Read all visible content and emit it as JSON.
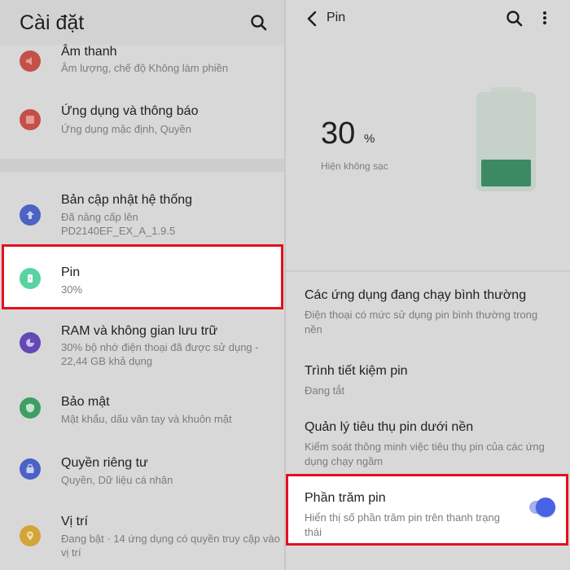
{
  "settings": {
    "title": "Cài đặt",
    "items": [
      {
        "key": "sound",
        "title": "Âm thanh",
        "subtitle": "Âm lượng, chế độ Không làm phiền",
        "color": "#c4504a"
      },
      {
        "key": "apps",
        "title": "Ứng dụng và thông báo",
        "subtitle": "Ứng dụng mặc định, Quyền",
        "color": "#c4504a"
      },
      {
        "key": "update",
        "title": "Bản cập nhật hệ thống",
        "subtitle": "Đã nâng cấp lên PD2140EF_EX_A_1.9.5",
        "color": "#4a63c4"
      },
      {
        "key": "battery",
        "title": "Pin",
        "subtitle": "30%",
        "color": "#59d3a1"
      },
      {
        "key": "ram",
        "title": "RAM và không gian lưu trữ",
        "subtitle": "30% bộ nhớ điện thoại đã được sử dụng - 22,44 GB khả dụng",
        "color": "#6448b5"
      },
      {
        "key": "security",
        "title": "Bảo mật",
        "subtitle": "Mật khẩu, dấu vân tay và khuôn mặt",
        "color": "#3f9e63"
      },
      {
        "key": "privacy",
        "title": "Quyền riêng tư",
        "subtitle": "Quyền, Dữ liệu cá nhân",
        "color": "#4a63c4"
      },
      {
        "key": "location",
        "title": "Vị trí",
        "subtitle": "Đang bật · 14 ứng dụng có quyền truy cập vào vị trí",
        "color": "#d2a537"
      }
    ]
  },
  "battery": {
    "title": "Pin",
    "percent": "30",
    "percent_unit": "%",
    "level": 0.3,
    "status": "Hiện không sạc",
    "items": [
      {
        "title": "Các ứng dụng đang chạy bình thường",
        "subtitle": "Điện thoại có mức sử dụng pin bình thường trong nền"
      },
      {
        "title": "Trình tiết kiệm pin",
        "subtitle": "Đang tắt"
      },
      {
        "title": "Quản lý tiêu thụ pin dưới nền",
        "subtitle": "Kiểm soát thông minh việc tiêu thụ pin của các ứng dụng chạy ngầm"
      },
      {
        "title": "Phần trăm pin",
        "subtitle": "Hiển thị số phần trăm pin trên thanh trạng thái",
        "toggle_on": true
      }
    ]
  },
  "colors": {
    "highlight": "#e3111d",
    "toggle": "#4763e6",
    "battery_fill": "#3c8a63"
  }
}
